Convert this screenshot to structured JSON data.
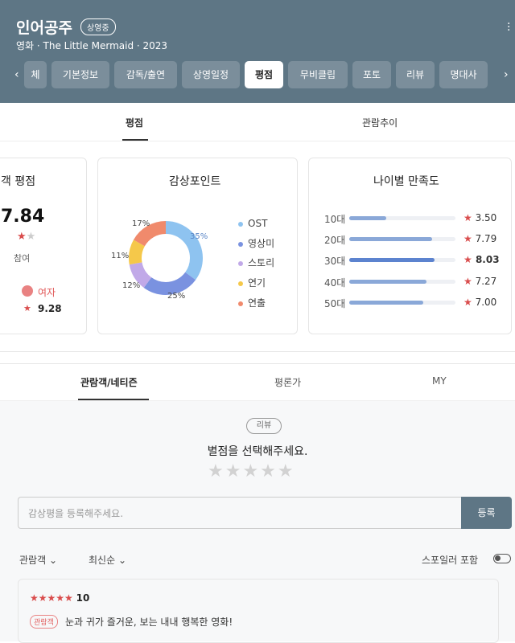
{
  "header": {
    "title": "인어공주",
    "badge": "상영중",
    "subtitle": "영화 · The Little Mermaid · 2023",
    "menu_icon": "more-vertical-icon"
  },
  "tabs": [
    "체",
    "기본정보",
    "감독/출연",
    "상영일정",
    "평점",
    "무비클립",
    "포토",
    "리뷰",
    "명대사"
  ],
  "active_tab": "평점",
  "subtabs": [
    "평점",
    "관람추이"
  ],
  "score_card": {
    "title": "객 평점",
    "score": "7.84",
    "participants": "참여",
    "female_label": "여자",
    "female_score": "9.28"
  },
  "points_card": {
    "title": "감상포인트",
    "legend": [
      "OST",
      "영상미",
      "스토리",
      "연기",
      "연출"
    ],
    "pcts": [
      "35%",
      "25%",
      "12%",
      "11%",
      "17%"
    ]
  },
  "age_card": {
    "title": "나이별 만족도",
    "ages": [
      "10대",
      "20대",
      "30대",
      "40대",
      "50대"
    ],
    "scores": [
      "3.50",
      "7.79",
      "8.03",
      "7.27",
      "7.00"
    ],
    "levels": [
      0.35,
      0.779,
      0.803,
      0.727,
      0.7
    ]
  },
  "review_tabs": [
    "관람객/네티즌",
    "평론가",
    "MY"
  ],
  "review_badge": "리뷰",
  "prompt": "별점을 선택해주세요.",
  "input_placeholder": "감상평을 등록해주세요.",
  "submit": "등록",
  "filters": [
    "관람객",
    "최신순"
  ],
  "spoiler": "스포일러 포함",
  "review": {
    "score": "10",
    "tag": "관람객",
    "text": "눈과 귀가 즐거운, 보는 내내 행복한 영화!"
  },
  "colors": {
    "header": "#5e7685",
    "star": "#d94c4c",
    "ost": "#8ec3f0",
    "visual": "#7a92e0",
    "story": "#c1a9e8",
    "acting": "#f5c84a",
    "direct": "#f08a6c"
  }
}
